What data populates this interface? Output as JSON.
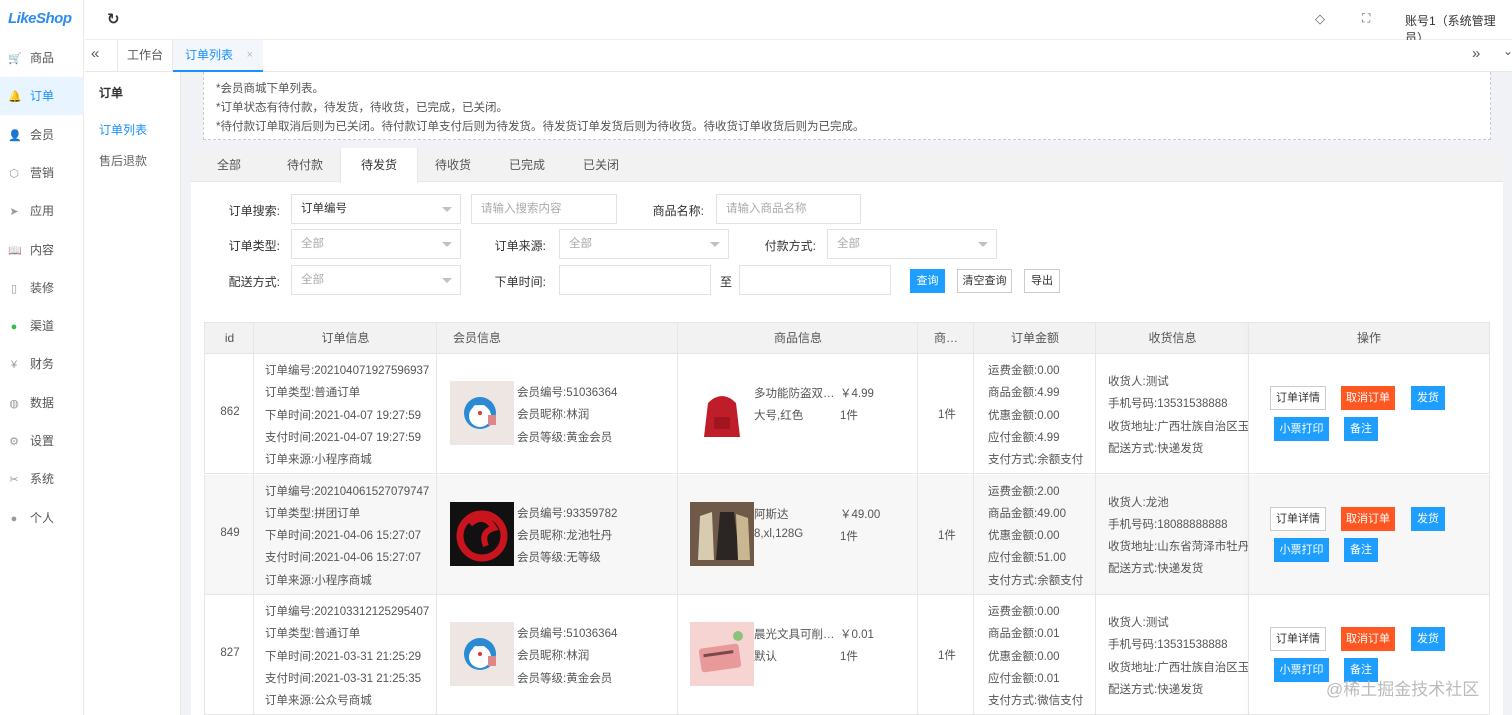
{
  "brand": {
    "logo": "LikeShop"
  },
  "nav": {
    "items": [
      {
        "label": "商品",
        "icon": "cart-icon"
      },
      {
        "label": "订单",
        "icon": "bell-icon"
      },
      {
        "label": "会员",
        "icon": "user-icon"
      },
      {
        "label": "营销",
        "icon": "cube-icon"
      },
      {
        "label": "应用",
        "icon": "send-icon"
      },
      {
        "label": "内容",
        "icon": "book-icon"
      },
      {
        "label": "装修",
        "icon": "phone-icon"
      },
      {
        "label": "渠道",
        "icon": "wechat-icon"
      },
      {
        "label": "财务",
        "icon": "yen-icon"
      },
      {
        "label": "数据",
        "icon": "globe-icon"
      },
      {
        "label": "设置",
        "icon": "gear-icon"
      },
      {
        "label": "系统",
        "icon": "tools-icon"
      },
      {
        "label": "个人",
        "icon": "person-icon"
      }
    ],
    "active": "订单"
  },
  "sub": {
    "title": "订单",
    "items": [
      "订单列表",
      "售后退款"
    ]
  },
  "topbar": {
    "account": "账号1（系统管理员）"
  },
  "tabs": {
    "items": [
      "工作台",
      "订单列表"
    ]
  },
  "tips": [
    "*会员商城下单列表。",
    "*订单状态有待付款，待发货，待收货，已完成，已关闭。",
    "*待付款订单取消后则为已关闭。待付款订单支付后则为待发货。待发货订单发货后则为待收货。待收货订单收货后则为已完成。"
  ],
  "status_tabs": {
    "items": [
      "全部",
      "待付款",
      "待发货",
      "待收货",
      "已完成",
      "已关闭"
    ],
    "active": "待发货"
  },
  "filters": {
    "search_label": "订单搜索:",
    "search_type": "订单编号",
    "search_placeholder": "请输入搜索内容",
    "goods_label": "商品名称:",
    "goods_placeholder": "请输入商品名称",
    "type_label": "订单类型:",
    "type_value": "全部",
    "source_label": "订单来源:",
    "source_value": "全部",
    "pay_label": "付款方式:",
    "pay_value": "全部",
    "delivery_label": "配送方式:",
    "delivery_value": "全部",
    "time_label": "下单时间:",
    "time_to": "至",
    "query": "查询",
    "clear": "清空查询",
    "export": "导出"
  },
  "table": {
    "headers": [
      "id",
      "订单信息",
      "会员信息",
      "商品信息",
      "商…",
      "订单金额",
      "收货信息",
      "操作"
    ],
    "actions": {
      "detail": "订单详情",
      "cancel": "取消订单",
      "ship": "发货",
      "print": "小票打印",
      "remark": "备注"
    },
    "rows": [
      {
        "id": "862",
        "order": [
          "订单编号:202104071927596937",
          "订单类型:普通订单",
          "下单时间:2021-04-07 19:27:59",
          "支付时间:2021-04-07 19:27:59",
          "订单来源:小程序商城"
        ],
        "member": [
          "会员编号:51036364",
          "会员昵称:林润",
          "会员等级:黄金会员"
        ],
        "avatar": "doraemon",
        "goods_name": "多功能防盗双…",
        "goods_spec": "大号,红色",
        "goods_price": "￥4.99",
        "goods_qty": "1件",
        "goods_image": "red-backpack",
        "count": "1件",
        "amount": [
          "运费金额:0.00",
          "商品金额:4.99",
          "优惠金额:0.00",
          "应付金额:4.99",
          "支付方式:余额支付"
        ],
        "receive": [
          "收货人:测试",
          "手机号码:13531538888",
          "收货地址:广西壮族自治区玉林",
          "配送方式:快递发货"
        ]
      },
      {
        "id": "849",
        "order": [
          "订单编号:202104061527079747",
          "订单类型:拼团订单",
          "下单时间:2021-04-06 15:27:07",
          "支付时间:2021-04-06 15:27:07",
          "订单来源:小程序商城"
        ],
        "member": [
          "会员编号:93359782",
          "会员昵称:龙池牡丹",
          "会员等级:无等级"
        ],
        "avatar": "red-dragon",
        "goods_name": "阿斯达",
        "goods_spec": "8,xl,128G",
        "goods_price": "￥49.00",
        "goods_qty": "1件",
        "goods_image": "coat",
        "count": "1件",
        "amount": [
          "运费金额:2.00",
          "商品金额:49.00",
          "优惠金额:0.00",
          "应付金额:51.00",
          "支付方式:余额支付"
        ],
        "receive": [
          "收货人:龙池",
          "手机号码:18088888888",
          "收货地址:山东省菏泽市牡丹区",
          "配送方式:快递发货"
        ]
      },
      {
        "id": "827",
        "order": [
          "订单编号:202103312125295407",
          "订单类型:普通订单",
          "下单时间:2021-03-31 21:25:29",
          "支付时间:2021-03-31 21:25:35",
          "订单来源:公众号商城"
        ],
        "member": [
          "会员编号:51036364",
          "会员昵称:林润",
          "会员等级:黄金会员"
        ],
        "avatar": "doraemon",
        "goods_name": "晨光文具可削…",
        "goods_spec": "默认",
        "goods_price": "￥0.01",
        "goods_qty": "1件",
        "goods_image": "pencils",
        "count": "1件",
        "amount": [
          "运费金额:0.00",
          "商品金额:0.01",
          "优惠金额:0.00",
          "应付金额:0.01",
          "支付方式:微信支付"
        ],
        "receive": [
          "收货人:测试",
          "手机号码:13531538888",
          "收货地址:广西壮族自治区玉林",
          "配送方式:快递发货"
        ]
      }
    ]
  },
  "watermark": "@稀土掘金技术社区"
}
